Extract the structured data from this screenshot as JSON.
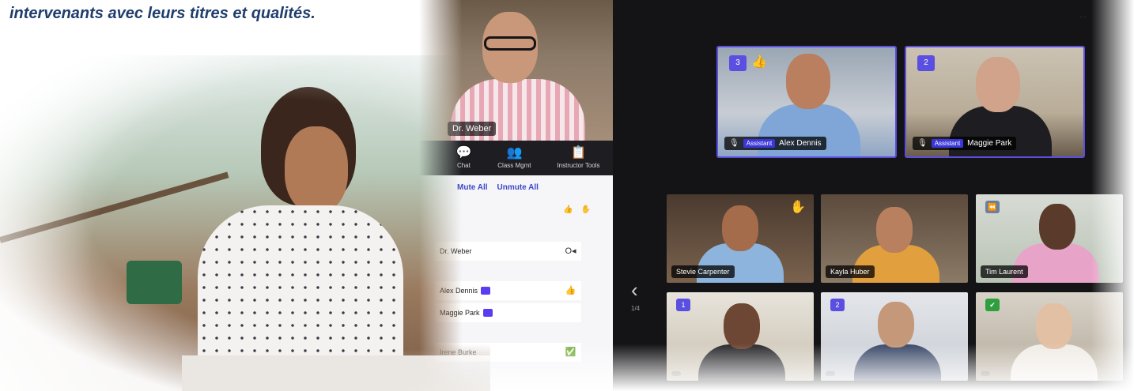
{
  "caption": "intervenants avec leurs titres et qualités.",
  "instructor": {
    "name": "Dr. Weber"
  },
  "toolbar": [
    {
      "label": "Chat",
      "icon": "chat-icon",
      "glyph": "💬"
    },
    {
      "label": "Class Mgmt",
      "icon": "class-management-icon",
      "glyph": "👥"
    },
    {
      "label": "Instructor Tools",
      "icon": "clipboard-icon",
      "glyph": "📋"
    }
  ],
  "panel": {
    "mute_all": "Mute All",
    "unmute_all": "Unmute All",
    "rows": [
      {
        "name": "Dr. Weber",
        "side": "O◂"
      },
      {
        "name": "Alex Dennis",
        "side": "👍"
      },
      {
        "name": "Maggie Park",
        "side": ""
      },
      {
        "name": "Irene Burke",
        "side": "✅"
      }
    ]
  },
  "assistants": [
    {
      "badge": "3",
      "role": "Assistant",
      "name": "Alex Dennis",
      "reaction": "👍"
    },
    {
      "badge": "2",
      "role": "Assistant",
      "name": "Maggie Park",
      "reaction": ""
    }
  ],
  "grid": [
    {
      "name": "Stevie Carpenter",
      "badge": "",
      "reaction": "✋"
    },
    {
      "name": "Kayla Huber",
      "badge": "",
      "reaction": ""
    },
    {
      "name": "Tim Laurent",
      "badge": "⏪",
      "reaction": ""
    },
    {
      "name": "",
      "badge": "1",
      "reaction": ""
    },
    {
      "name": "",
      "badge": "2",
      "reaction": ""
    },
    {
      "name": "",
      "badge": "✔",
      "reaction": ""
    }
  ],
  "pager": "1/4",
  "colors": {
    "accent": "#5a4fe0",
    "panel_link": "#3d46c9",
    "caption": "#1f3d6d"
  }
}
